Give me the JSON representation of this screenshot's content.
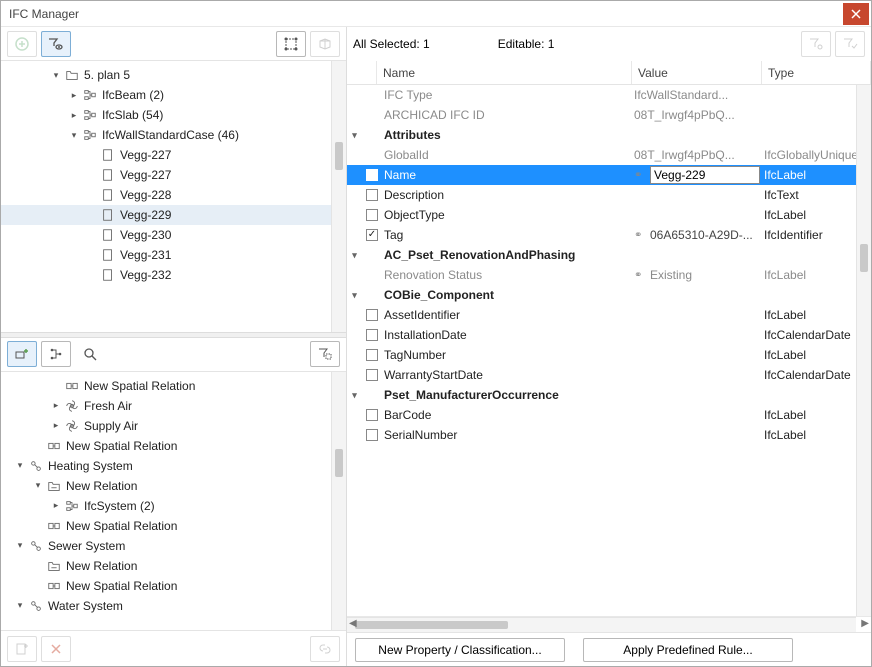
{
  "window": {
    "title": "IFC Manager"
  },
  "left_toolbar": {
    "btn1": "new",
    "btn2": "filter-select"
  },
  "tree_top": [
    {
      "indent": 2,
      "exp": "down",
      "icon": "folder",
      "label": "5. plan 5"
    },
    {
      "indent": 3,
      "exp": "right",
      "icon": "struct",
      "label": "IfcBeam (2)"
    },
    {
      "indent": 3,
      "exp": "right",
      "icon": "struct",
      "label": "IfcSlab (54)"
    },
    {
      "indent": 3,
      "exp": "down",
      "icon": "struct",
      "label": "IfcWallStandardCase (46)"
    },
    {
      "indent": 4,
      "exp": "",
      "icon": "sheet",
      "label": "Vegg-227"
    },
    {
      "indent": 4,
      "exp": "",
      "icon": "sheet",
      "label": "Vegg-227"
    },
    {
      "indent": 4,
      "exp": "",
      "icon": "sheet",
      "label": "Vegg-228"
    },
    {
      "indent": 4,
      "exp": "",
      "icon": "sheet",
      "label": "Vegg-229",
      "selected": true
    },
    {
      "indent": 4,
      "exp": "",
      "icon": "sheet",
      "label": "Vegg-230"
    },
    {
      "indent": 4,
      "exp": "",
      "icon": "sheet",
      "label": "Vegg-231"
    },
    {
      "indent": 4,
      "exp": "",
      "icon": "sheet",
      "label": "Vegg-232"
    }
  ],
  "tree_bottom": [
    {
      "indent": 2,
      "exp": "",
      "icon": "relation",
      "label": "New Spatial Relation"
    },
    {
      "indent": 2,
      "exp": "right",
      "icon": "fan",
      "label": "Fresh Air"
    },
    {
      "indent": 2,
      "exp": "right",
      "icon": "fan",
      "label": "Supply Air"
    },
    {
      "indent": 1,
      "exp": "",
      "icon": "relation",
      "label": "New Spatial Relation"
    },
    {
      "indent": 0,
      "exp": "down",
      "icon": "system",
      "label": "Heating System"
    },
    {
      "indent": 1,
      "exp": "down",
      "icon": "folderrel",
      "label": "New Relation"
    },
    {
      "indent": 2,
      "exp": "right",
      "icon": "struct",
      "label": "IfcSystem (2)"
    },
    {
      "indent": 1,
      "exp": "",
      "icon": "relation",
      "label": "New Spatial Relation"
    },
    {
      "indent": 0,
      "exp": "down",
      "icon": "system",
      "label": "Sewer System"
    },
    {
      "indent": 1,
      "exp": "",
      "icon": "folderrel",
      "label": "New Relation"
    },
    {
      "indent": 1,
      "exp": "",
      "icon": "relation",
      "label": "New Spatial Relation"
    },
    {
      "indent": 0,
      "exp": "down",
      "icon": "system",
      "label": "Water System"
    }
  ],
  "info": {
    "all_selected": "All Selected: 1",
    "editable": "Editable: 1"
  },
  "prop_header": {
    "name": "Name",
    "value": "Value",
    "type": "Type"
  },
  "props": [
    {
      "kind": "dim",
      "name": "IFC Type",
      "value": "IfcWallStandard...",
      "type": ""
    },
    {
      "kind": "dim",
      "name": "ARCHICAD IFC ID",
      "value": "08T_Irwgf4pPbQ...",
      "type": ""
    },
    {
      "kind": "hdr",
      "name": "Attributes"
    },
    {
      "kind": "dim",
      "name": "GlobalId",
      "value": "08T_Irwgf4pPbQ...",
      "type": "IfcGloballyUniqueId"
    },
    {
      "kind": "sel",
      "chk": true,
      "name": "Name",
      "value": "Vegg-229",
      "type": "IfcLabel",
      "link": true
    },
    {
      "kind": "row",
      "chk": false,
      "name": "Description",
      "value": "",
      "type": "IfcText"
    },
    {
      "kind": "row",
      "chk": false,
      "name": "ObjectType",
      "value": "",
      "type": "IfcLabel"
    },
    {
      "kind": "row",
      "chk": true,
      "name": "Tag",
      "value": "06A65310-A29D-...",
      "type": "IfcIdentifier",
      "link": true
    },
    {
      "kind": "hdr",
      "name": "AC_Pset_RenovationAndPhasing"
    },
    {
      "kind": "dim",
      "name": "Renovation Status",
      "value": "Existing",
      "type": "IfcLabel",
      "link": true
    },
    {
      "kind": "hdr",
      "name": "COBie_Component"
    },
    {
      "kind": "row",
      "chk": false,
      "name": "AssetIdentifier",
      "value": "",
      "type": "IfcLabel"
    },
    {
      "kind": "row",
      "chk": false,
      "name": "InstallationDate",
      "value": "",
      "type": "IfcCalendarDate"
    },
    {
      "kind": "row",
      "chk": false,
      "name": "TagNumber",
      "value": "",
      "type": "IfcLabel"
    },
    {
      "kind": "row",
      "chk": false,
      "name": "WarrantyStartDate",
      "value": "",
      "type": "IfcCalendarDate"
    },
    {
      "kind": "hdr",
      "name": "Pset_ManufacturerOccurrence"
    },
    {
      "kind": "row",
      "chk": false,
      "name": "BarCode",
      "value": "",
      "type": "IfcLabel"
    },
    {
      "kind": "row",
      "chk": false,
      "name": "SerialNumber",
      "value": "",
      "type": "IfcLabel"
    }
  ],
  "footer": {
    "new_prop": "New Property / Classification...",
    "apply_rule": "Apply Predefined Rule..."
  }
}
